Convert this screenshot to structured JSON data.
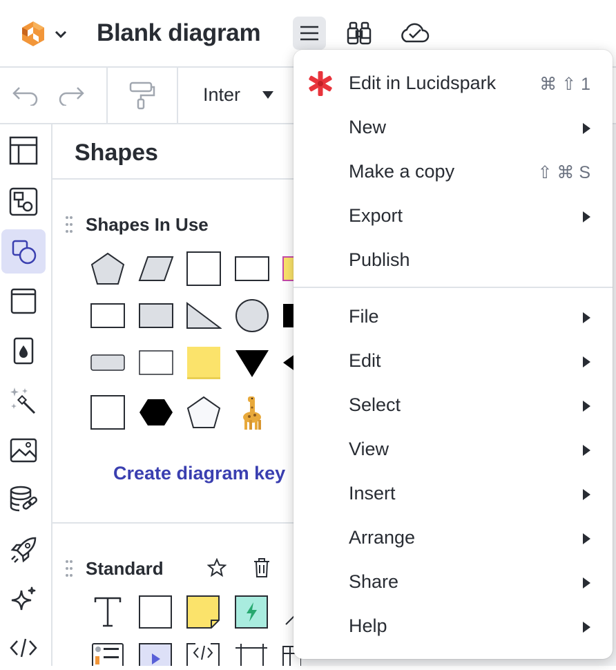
{
  "header": {
    "title": "Blank diagram"
  },
  "toolbar": {
    "font": "Inter"
  },
  "panel": {
    "title": "Shapes",
    "sections": [
      {
        "title": "Shapes In Use"
      },
      {
        "title": "Standard"
      }
    ],
    "diagram_key_link": "Create diagram key"
  },
  "menu": {
    "items": [
      {
        "label": "Edit in Lucidspark",
        "shortcut": "⌘ ⇧ 1",
        "submenu": false
      },
      {
        "label": "New",
        "shortcut": "",
        "submenu": true
      },
      {
        "label": "Make a copy",
        "shortcut": "⇧ ⌘ S",
        "submenu": false
      },
      {
        "label": "Export",
        "shortcut": "",
        "submenu": true
      },
      {
        "label": "Publish",
        "shortcut": "",
        "submenu": false
      },
      {
        "label": "File",
        "shortcut": "",
        "submenu": true
      },
      {
        "label": "Edit",
        "shortcut": "",
        "submenu": true
      },
      {
        "label": "Select",
        "shortcut": "",
        "submenu": true
      },
      {
        "label": "View",
        "shortcut": "",
        "submenu": true
      },
      {
        "label": "Insert",
        "shortcut": "",
        "submenu": true
      },
      {
        "label": "Arrange",
        "shortcut": "",
        "submenu": true
      },
      {
        "label": "Share",
        "shortcut": "",
        "submenu": true
      },
      {
        "label": "Help",
        "shortcut": "",
        "submenu": true
      }
    ]
  },
  "colors": {
    "accent": "#3a3fb0",
    "rail_active_bg": "#dde0f7",
    "lucidspark_red": "#e8343c",
    "sticky_yellow": "#fbe36b",
    "shape_fill_gray": "#dcdfe4"
  },
  "icons": {
    "logo": "lucid-logo-icon",
    "menu": "hamburger-icon",
    "find": "binoculars-icon",
    "save_status": "cloud-check-icon",
    "undo": "undo-icon",
    "redo": "redo-icon",
    "format_painter": "paint-roller-icon"
  }
}
